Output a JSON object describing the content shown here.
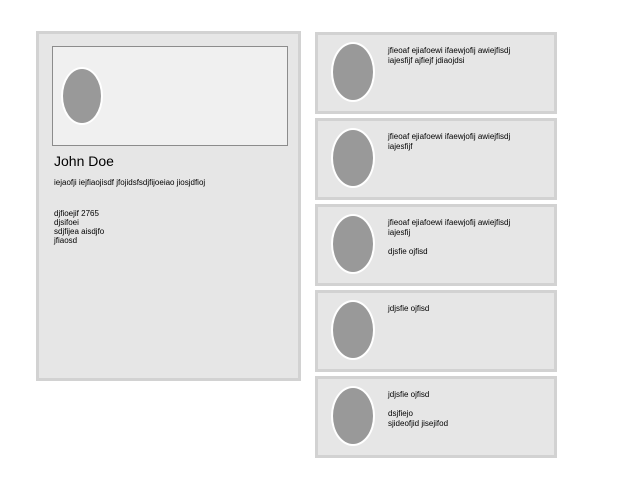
{
  "profile": {
    "name": "John Doe",
    "bio": "iejaofji iejfiaojisdf jfojidsfsdjfijoeiao jiosjdfioj",
    "details": [
      "djfioejif 2765",
      "djsifoei",
      "sdjfijea aisdjfo",
      "jfiaosd"
    ]
  },
  "feed": [
    {
      "lines": [
        "jfieoaf ejiafoewi ifaewjofij awiejfisdj",
        "iajesfijf ajfiejf jdiaojdsi"
      ],
      "extra": []
    },
    {
      "lines": [
        "jfieoaf ejiafoewi ifaewjofij awiejfisdj",
        "iajesfijf"
      ],
      "extra": []
    },
    {
      "lines": [
        "jfieoaf ejiafoewi ifaewjofij awiejfisdj",
        "iajesfij"
      ],
      "extra": [
        "djsfie ojfisd"
      ]
    },
    {
      "lines": [
        "jdjsfie ojfisd"
      ],
      "extra": []
    },
    {
      "lines": [
        "jdjsfie ojfisd"
      ],
      "extra": [
        "dsjfiejo",
        "sjideofjid jisejifod"
      ]
    }
  ]
}
